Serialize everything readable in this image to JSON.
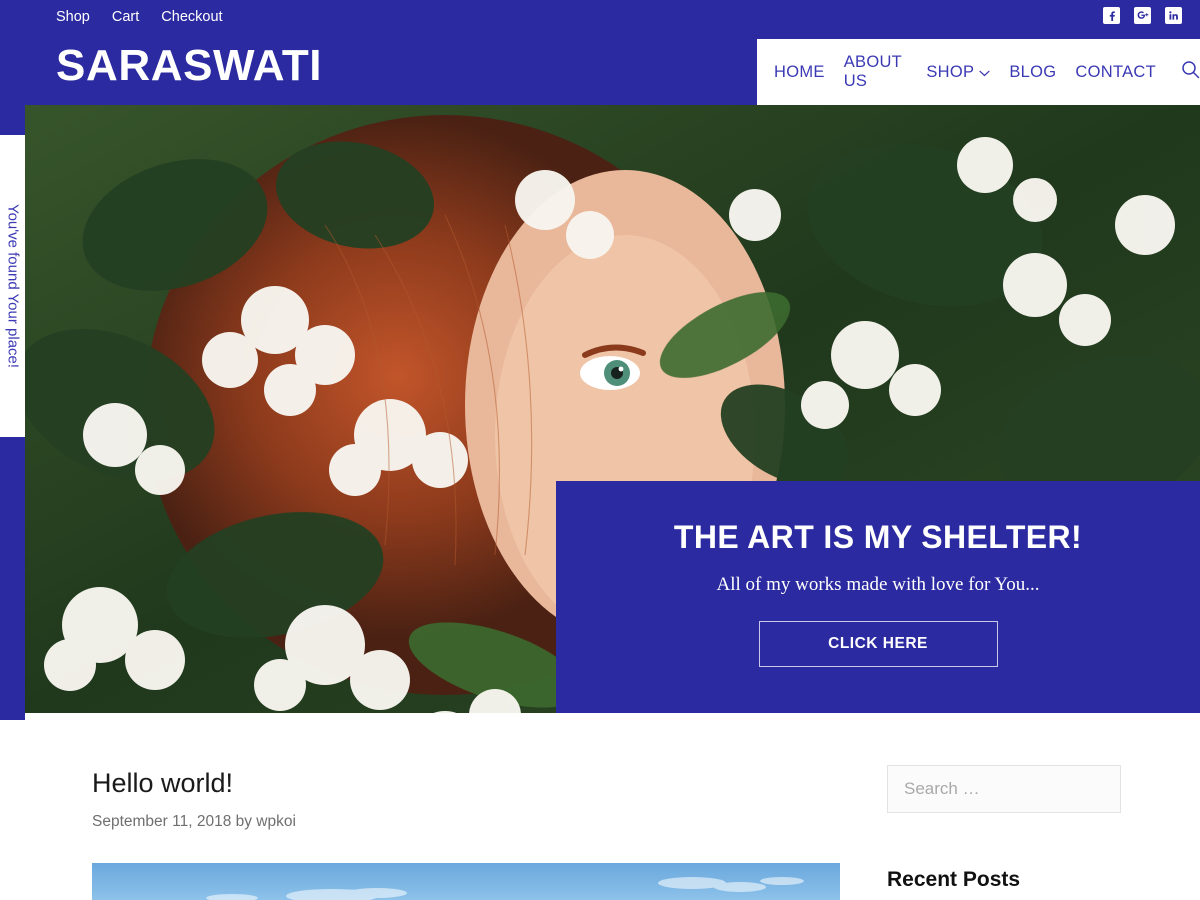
{
  "topbar": {
    "links": [
      {
        "label": "Shop"
      },
      {
        "label": "Cart"
      },
      {
        "label": "Checkout"
      }
    ],
    "social": [
      {
        "name": "facebook-icon",
        "glyph": "f"
      },
      {
        "name": "google-plus-icon",
        "glyph": "G+"
      },
      {
        "name": "linkedin-icon",
        "glyph": "in"
      }
    ]
  },
  "header": {
    "site_title": "SARASWATI",
    "nav": [
      {
        "label": "HOME",
        "has_dropdown": false
      },
      {
        "label": "ABOUT US",
        "has_dropdown": false
      },
      {
        "label": "SHOP",
        "has_dropdown": true
      },
      {
        "label": "BLOG",
        "has_dropdown": false
      },
      {
        "label": "CONTACT",
        "has_dropdown": false
      }
    ],
    "search_icon": "search-icon"
  },
  "side_tab": {
    "text": "You've found Your place!"
  },
  "hero": {
    "title": "THE ART IS MY SHELTER!",
    "subtitle": "All of my works made with love for You...",
    "button_label": "CLICK HERE"
  },
  "post": {
    "title": "Hello world!",
    "meta": "September 11, 2018 by wpkoi"
  },
  "sidebar": {
    "search_placeholder": "Search …",
    "search_value": "",
    "recent_posts_title": "Recent Posts"
  },
  "colors": {
    "brand_blue": "#2b2aa0",
    "nav_link": "#3b39b4",
    "white": "#ffffff"
  }
}
